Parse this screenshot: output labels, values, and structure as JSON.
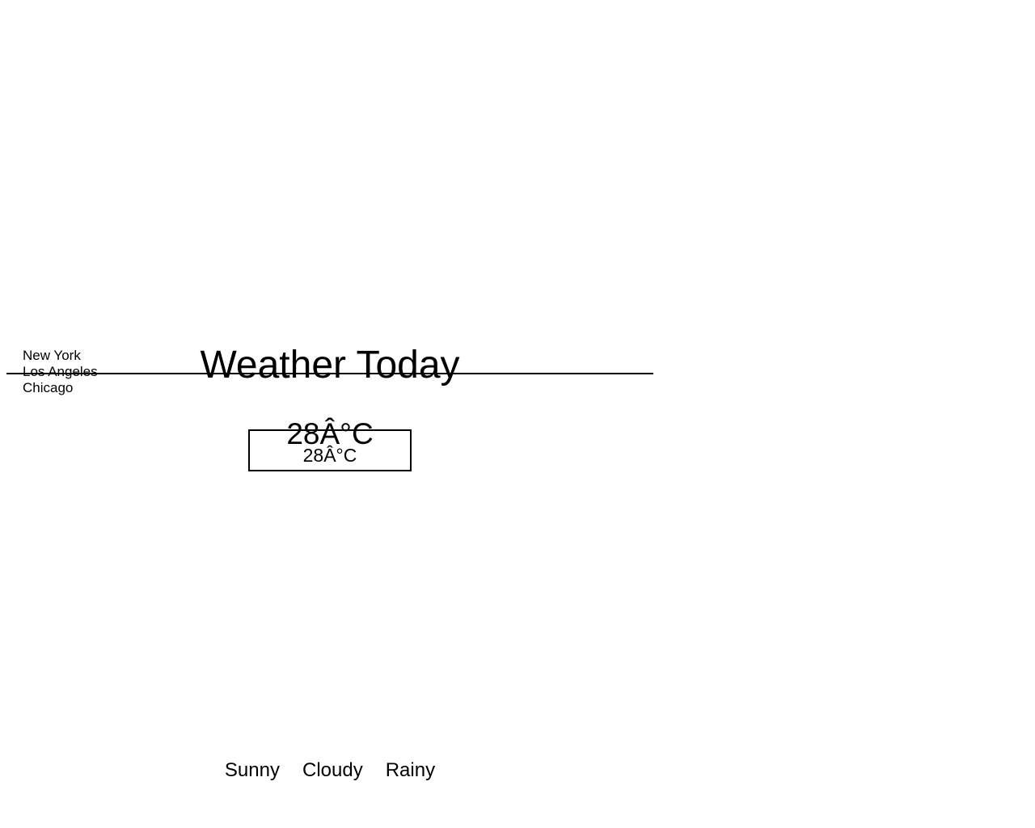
{
  "header": {
    "title": "Weather Today"
  },
  "cities": [
    {
      "label": "New York"
    },
    {
      "label": "Los Angeles"
    },
    {
      "label": "Chicago"
    }
  ],
  "current": {
    "temperature": "28Â°C",
    "temperature_box": "28Â°C"
  },
  "conditions": [
    {
      "label": "Sunny"
    },
    {
      "label": "Cloudy"
    },
    {
      "label": "Rainy"
    }
  ]
}
